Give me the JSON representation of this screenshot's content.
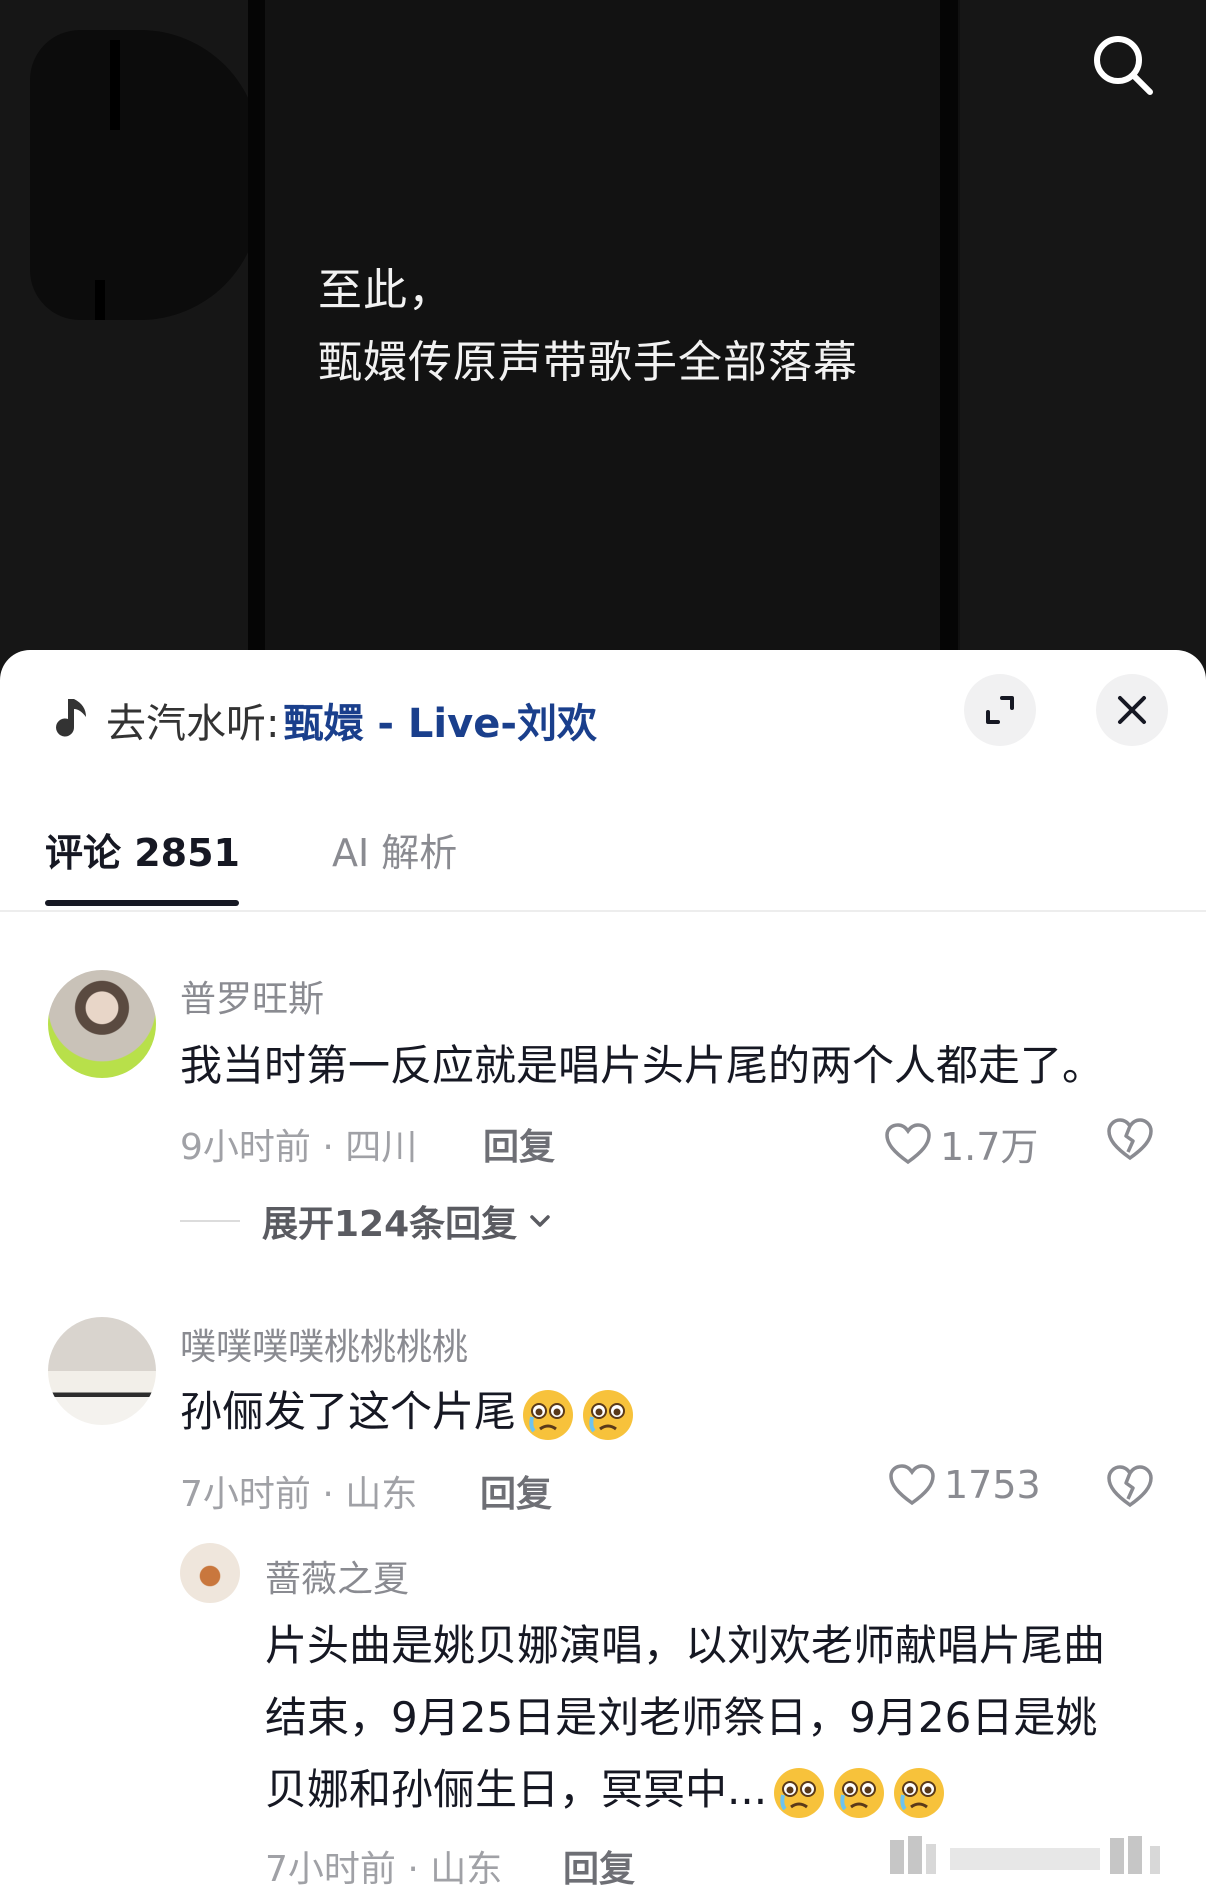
{
  "video": {
    "caption_line1": "至此，",
    "caption_line2": "甄嬛传原声带歌手全部落幕"
  },
  "music_bar": {
    "prefix": "去汽水听:",
    "song": "甄嬛 - Live-刘欢"
  },
  "tabs": {
    "comments": "评论 2851",
    "ai": "AI 解析"
  },
  "comments": [
    {
      "user": "普罗旺斯",
      "text": "我当时第一反应就是唱片头片尾的两个人都走了。",
      "meta": "9小时前 · 四川",
      "reply": "回复",
      "likes": "1.7万",
      "expand": "展开124条回复"
    },
    {
      "user": "噗噗噗噗桃桃桃桃",
      "text": "孙俪发了这个片尾",
      "meta": "7小时前 · 山东",
      "reply": "回复",
      "likes": "1753"
    }
  ],
  "sub_reply": {
    "user": "蔷薇之夏",
    "line1": "片头曲是姚贝娜演唱，以刘欢老师献唱片尾曲",
    "line2": "结束，9月25日是刘老师祭日，9月26日是姚",
    "line3": "贝娜和孙俪生日，冥冥中...",
    "meta": "7小时前 · 山东",
    "reply": "回复"
  },
  "colors": {
    "accent_link": "#1a3f8c",
    "text_primary": "#161823",
    "text_secondary": "#8a8b91"
  }
}
